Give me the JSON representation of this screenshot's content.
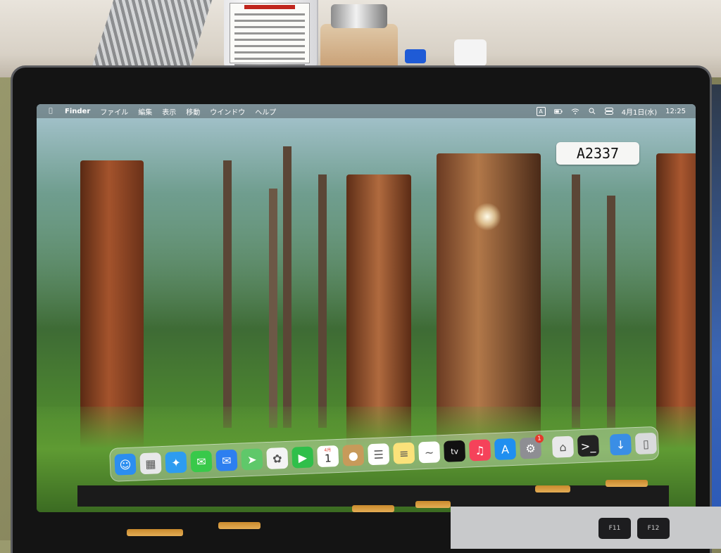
{
  "menubar": {
    "apple_icon": "apple-icon",
    "app_name": "Finder",
    "menus": [
      "ファイル",
      "編集",
      "表示",
      "移動",
      "ウインドウ",
      "ヘルプ"
    ],
    "status": {
      "input_source": "A",
      "battery": "battery-icon",
      "wifi": "wifi-icon",
      "search": "search-icon",
      "control_center": "control-center-icon",
      "date": "4月1日(水)",
      "time": "12:25"
    }
  },
  "sticker": {
    "text": "A2337"
  },
  "dock": {
    "apps": [
      {
        "name": "Finder",
        "icon": "finder-icon",
        "color": "#2c8ef0"
      },
      {
        "name": "Launchpad",
        "icon": "launchpad-icon",
        "color": "#e8e8ea"
      },
      {
        "name": "Safari",
        "icon": "safari-icon",
        "color": "#2d9cf0"
      },
      {
        "name": "Messages",
        "icon": "messages-icon",
        "color": "#38c94a"
      },
      {
        "name": "Mail",
        "icon": "mail-icon",
        "color": "#2d7ff0"
      },
      {
        "name": "Maps",
        "icon": "maps-icon",
        "color": "#5fc86a"
      },
      {
        "name": "Photos",
        "icon": "photos-icon",
        "color": "#f4f4f4"
      },
      {
        "name": "FaceTime",
        "icon": "facetime-icon",
        "color": "#2fbf4a"
      },
      {
        "name": "Calendar",
        "icon": "calendar-icon",
        "color": "#ffffff",
        "month": "4月",
        "day": "1"
      },
      {
        "name": "Contacts",
        "icon": "contacts-icon",
        "color": "#c79a5a"
      },
      {
        "name": "Reminders",
        "icon": "reminders-icon",
        "color": "#ffffff"
      },
      {
        "name": "Notes",
        "icon": "notes-icon",
        "color": "#fbe27a"
      },
      {
        "name": "Freeform",
        "icon": "freeform-icon",
        "color": "#ffffff"
      },
      {
        "name": "TV",
        "icon": "tv-icon",
        "color": "#111111",
        "label": "tv"
      },
      {
        "name": "Music",
        "icon": "music-icon",
        "color": "#f5425a"
      },
      {
        "name": "App Store",
        "icon": "app-store-icon",
        "color": "#1f8ff0"
      },
      {
        "name": "System Settings",
        "icon": "system-settings-icon",
        "color": "#8e8e93",
        "badge": "1"
      }
    ],
    "utilities": [
      {
        "name": "Installer",
        "icon": "installer-icon",
        "color": "#e8e8ea"
      },
      {
        "name": "Terminal",
        "icon": "terminal-icon",
        "color": "#222222"
      }
    ],
    "stacks": [
      {
        "name": "Downloads",
        "icon": "downloads-folder-icon",
        "color": "#3a8ee6"
      },
      {
        "name": "Trash",
        "icon": "trash-icon",
        "color": "#d9dadc"
      }
    ]
  },
  "keyboard": {
    "keys": [
      "F11",
      "F12"
    ]
  }
}
